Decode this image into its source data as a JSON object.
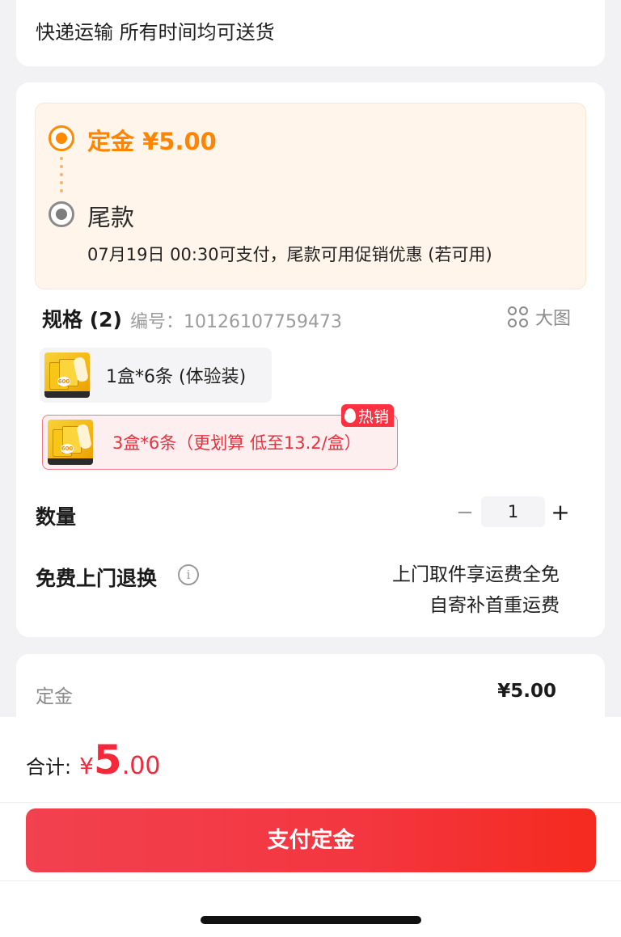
{
  "shipping": {
    "text": "快递运输 所有时间均可送货"
  },
  "payment": {
    "deposit_label": "定金 ¥5.00",
    "balance_label": "尾款",
    "balance_desc": "07月19日 00:30可支付，尾款可用促销优惠 (若可用)",
    "accent_color": "#ff8400"
  },
  "spec": {
    "title": "规格 (2)",
    "code": "编号：10126107759473",
    "big_image_label": "大图",
    "options": [
      {
        "label": "1盒*6条 (体验装)",
        "selected": false
      },
      {
        "label": "3盒*6条（更划算 低至13.2/盒）",
        "selected": true,
        "tag": "热销"
      }
    ]
  },
  "quantity": {
    "label": "数量",
    "minus": "−",
    "value": "1",
    "plus": "+"
  },
  "return": {
    "label": "免费上门退换",
    "info_icon": "i",
    "desc_line1": "上门取件享运费全免",
    "desc_line2": "自寄补首重运费"
  },
  "summary": {
    "label": "定金",
    "value": "¥5.00"
  },
  "total": {
    "label": "合计:",
    "yen": "¥",
    "int": "5",
    "dec": ".00",
    "color": "#f4283a"
  },
  "action": {
    "pay_label": "支付定金"
  }
}
